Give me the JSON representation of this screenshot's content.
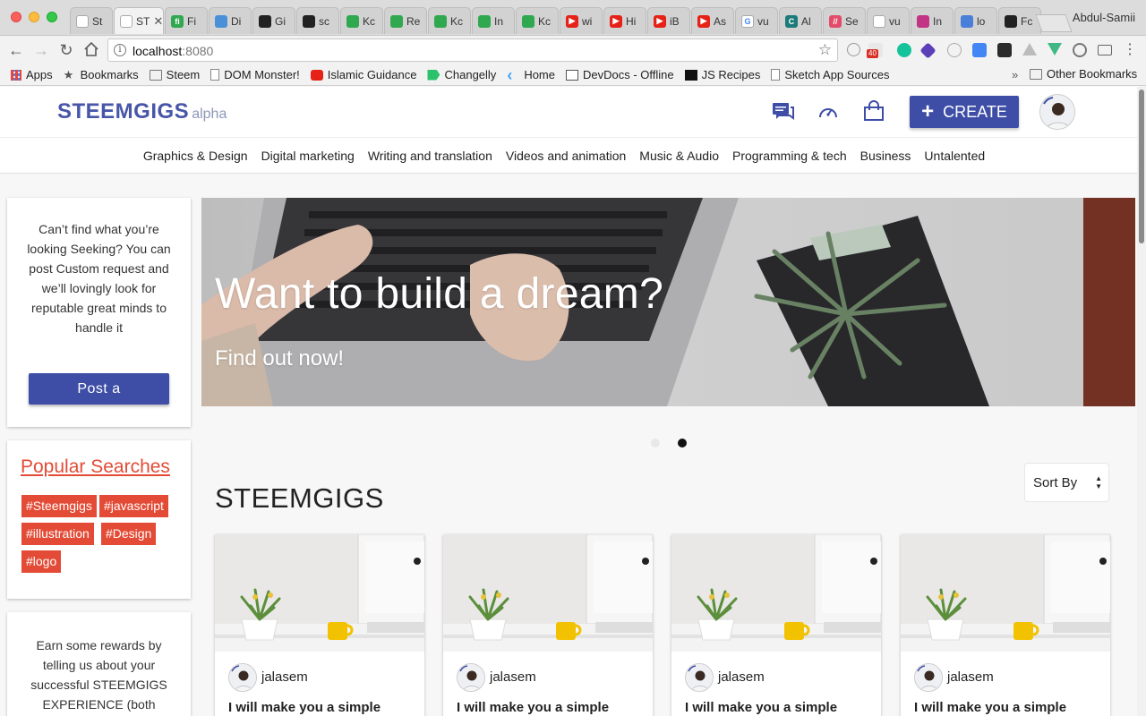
{
  "browser": {
    "tabs": [
      {
        "label": "St",
        "color": "#ffffff",
        "glyph": ""
      },
      {
        "label": "ST",
        "color": "#ffffff",
        "glyph": "",
        "active": true
      },
      {
        "label": "Fi",
        "color": "#2fa84f",
        "glyph": "fi"
      },
      {
        "label": "Di",
        "color": "#4a90d9",
        "glyph": ""
      },
      {
        "label": "Gi",
        "color": "#222222",
        "glyph": ""
      },
      {
        "label": "sc",
        "color": "#222222",
        "glyph": ""
      },
      {
        "label": "Kc",
        "color": "#2fa84f",
        "glyph": ""
      },
      {
        "label": "Re",
        "color": "#2fa84f",
        "glyph": ""
      },
      {
        "label": "Kc",
        "color": "#2fa84f",
        "glyph": ""
      },
      {
        "label": "In",
        "color": "#2fa84f",
        "glyph": ""
      },
      {
        "label": "Kc",
        "color": "#2fa84f",
        "glyph": ""
      },
      {
        "label": "wi",
        "color": "#e62117",
        "glyph": "▶"
      },
      {
        "label": "Hi",
        "color": "#e62117",
        "glyph": "▶"
      },
      {
        "label": "iB",
        "color": "#e62117",
        "glyph": "▶"
      },
      {
        "label": "As",
        "color": "#e62117",
        "glyph": "▶"
      },
      {
        "label": "vu",
        "color": "#ffffff",
        "glyph": "G"
      },
      {
        "label": "Al",
        "color": "#1d7a7a",
        "glyph": "C"
      },
      {
        "label": "Se",
        "color": "#e34b6b",
        "glyph": "//"
      },
      {
        "label": "vu",
        "color": "#ffffff",
        "glyph": ""
      },
      {
        "label": "In",
        "color": "#c13584",
        "glyph": ""
      },
      {
        "label": "lo",
        "color": "#4a7fd9",
        "glyph": ""
      },
      {
        "label": "Fc",
        "color": "#222222",
        "glyph": ""
      }
    ],
    "profile_name": "Abdul-Samii",
    "url_host": "localhost",
    "url_port": ":8080",
    "badge_count": "40",
    "bookmarks": [
      {
        "label": "Apps",
        "icon": "apps-grid-icon"
      },
      {
        "label": "Bookmarks",
        "icon": "star-icon"
      },
      {
        "label": "Steem",
        "icon": "folder-icon"
      },
      {
        "label": "DOM Monster!",
        "icon": "page-icon"
      },
      {
        "label": "Islamic Guidance",
        "icon": "youtube-icon"
      },
      {
        "label": "Changelly",
        "icon": "changelly-icon"
      },
      {
        "label": "Home",
        "icon": "flutter-icon"
      },
      {
        "label": "DevDocs - Offline",
        "icon": "devdocs-icon"
      },
      {
        "label": "JS Recipes",
        "icon": "terminal-icon"
      },
      {
        "label": "Sketch App Sources",
        "icon": "page-icon"
      }
    ],
    "other_bookmarks": "Other Bookmarks"
  },
  "header": {
    "logo": "STEEMGIGS",
    "logo_tag": "alpha",
    "create_label": "CREATE",
    "accent": "#3e4ea6"
  },
  "categories": [
    "Graphics & Design",
    "Digital marketing",
    "Writing and translation",
    "Videos and animation",
    "Music & Audio",
    "Programming & tech",
    "Business",
    "Untalented"
  ],
  "sidebar": {
    "cta_text": "Can’t find what you’re looking Seeking? You can post Custom request and we’ll lovingly look for reputable great minds to handle it",
    "post_label": "Post a",
    "popular_title": "Popular Searches",
    "tags": [
      "#Steemgigs",
      "#javascript",
      "#illustration",
      "#Design",
      "#logo"
    ],
    "earn_text": "Earn some rewards by telling us about your successful STEEMGIGS EXPERIENCE (both",
    "tag_color": "#e34b36"
  },
  "hero": {
    "title": "Want to build a dream?",
    "subtitle": "Find out now!",
    "slides": 2,
    "active_slide": 2
  },
  "gigs_section": {
    "title": "STEEMGIGS",
    "sort_label": "Sort By",
    "gigs": [
      {
        "user": "jalasem",
        "title": "I will make you a simple"
      },
      {
        "user": "jalasem",
        "title": "I will make you a simple"
      },
      {
        "user": "jalasem",
        "title": "I will make you a simple"
      },
      {
        "user": "jalasem",
        "title": "I will make you a simple"
      }
    ]
  }
}
